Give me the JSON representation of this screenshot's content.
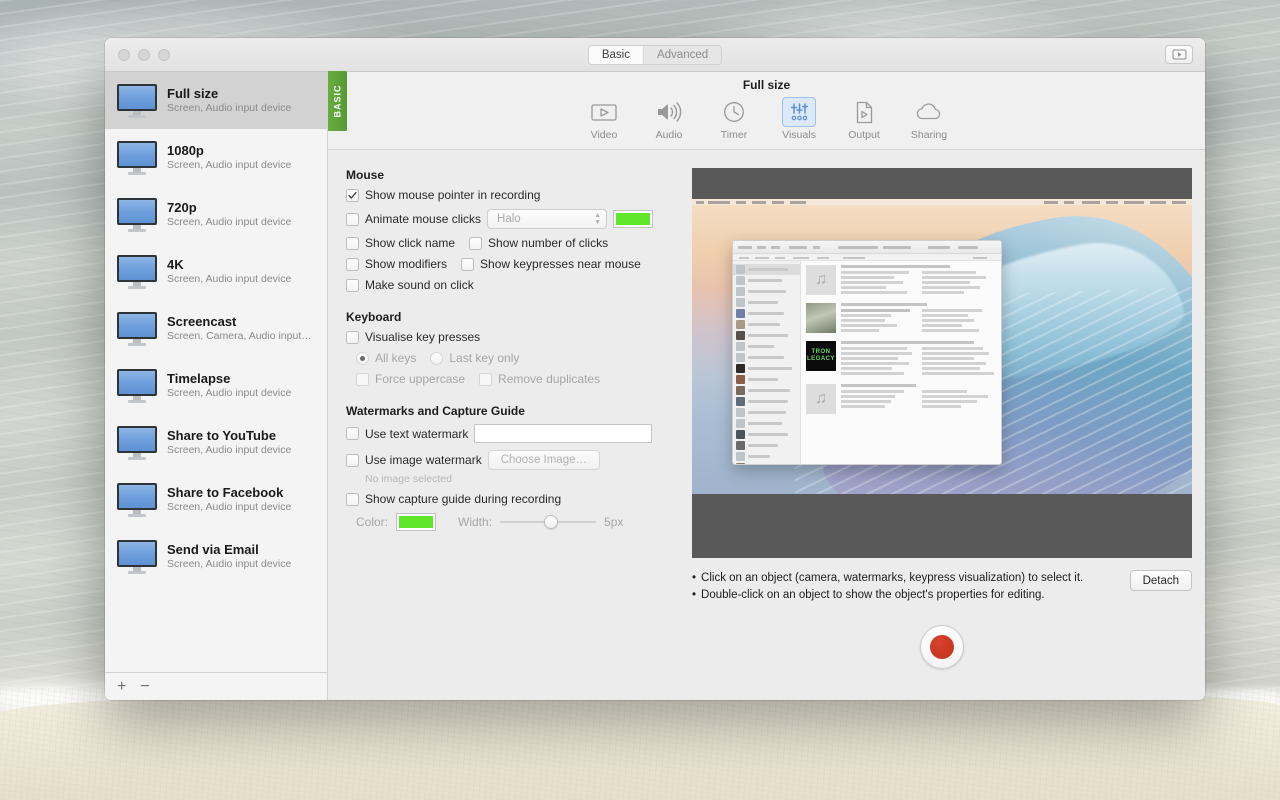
{
  "window": {
    "traffic_lights": [
      "close",
      "minimize",
      "zoom"
    ],
    "mode_tabs": [
      {
        "label": "Basic",
        "selected": true
      },
      {
        "label": "Advanced",
        "selected": false
      }
    ],
    "toolbar_right_icon": "video-play-icon",
    "basic_tab_label": "BASIC"
  },
  "sidebar": {
    "items": [
      {
        "title": "Full size",
        "subtitle": "Screen, Audio input device",
        "icon": "monitor-icon",
        "selected": true
      },
      {
        "title": "1080p",
        "subtitle": "Screen, Audio input device",
        "icon": "monitor-icon",
        "selected": false
      },
      {
        "title": "720p",
        "subtitle": "Screen, Audio input device",
        "icon": "monitor-icon",
        "selected": false
      },
      {
        "title": "4K",
        "subtitle": "Screen, Audio input device",
        "icon": "monitor-icon",
        "selected": false
      },
      {
        "title": "Screencast",
        "subtitle": "Screen, Camera, Audio input…",
        "icon": "monitor-icon",
        "selected": false
      },
      {
        "title": "Timelapse",
        "subtitle": "Screen, Audio input device",
        "icon": "monitor-icon",
        "selected": false
      },
      {
        "title": "Share to YouTube",
        "subtitle": "Screen, Audio input device",
        "icon": "monitor-icon",
        "selected": false
      },
      {
        "title": "Share to Facebook",
        "subtitle": "Screen, Audio input device",
        "icon": "monitor-icon",
        "selected": false
      },
      {
        "title": "Send via Email",
        "subtitle": "Screen, Audio input device",
        "icon": "monitor-icon",
        "selected": false
      }
    ],
    "footer": {
      "add_label": "+",
      "remove_label": "−"
    }
  },
  "main": {
    "panel_title": "Full size",
    "tools": [
      {
        "label": "Video",
        "icon": "video-icon",
        "active": false
      },
      {
        "label": "Audio",
        "icon": "speaker-icon",
        "active": false
      },
      {
        "label": "Timer",
        "icon": "clock-icon",
        "active": false
      },
      {
        "label": "Visuals",
        "icon": "sliders-icon",
        "active": true
      },
      {
        "label": "Output",
        "icon": "document-play-icon",
        "active": false
      },
      {
        "label": "Sharing",
        "icon": "cloud-icon",
        "active": false
      }
    ],
    "mouse": {
      "title": "Mouse",
      "show_pointer": {
        "label": "Show mouse pointer in recording",
        "checked": true
      },
      "animate_clicks": {
        "label": "Animate mouse clicks",
        "checked": false
      },
      "animation_style": {
        "value": "Halo",
        "enabled": false
      },
      "animation_color": "#5FE52A",
      "show_click_name": {
        "label": "Show click name",
        "checked": false
      },
      "show_number_of_clicks": {
        "label": "Show number of clicks",
        "checked": false
      },
      "show_modifiers": {
        "label": "Show modifiers",
        "checked": false
      },
      "show_keypresses_near_mouse": {
        "label": "Show keypresses near mouse",
        "checked": false
      },
      "make_sound_on_click": {
        "label": "Make sound on click",
        "checked": false
      }
    },
    "keyboard": {
      "title": "Keyboard",
      "visualise": {
        "label": "Visualise key presses",
        "checked": false
      },
      "radios": [
        {
          "label": "All keys",
          "selected": true
        },
        {
          "label": "Last key only",
          "selected": false
        }
      ],
      "force_uppercase": {
        "label": "Force uppercase",
        "checked": false
      },
      "remove_duplicates": {
        "label": "Remove duplicates",
        "checked": false
      }
    },
    "watermarks": {
      "title": "Watermarks and Capture Guide",
      "use_text_watermark": {
        "label": "Use text watermark",
        "checked": false
      },
      "text_watermark_value": "",
      "use_image_watermark": {
        "label": "Use image watermark",
        "checked": false
      },
      "choose_image_button": "Choose Image…",
      "no_image_selected": "No image selected",
      "show_capture_guide": {
        "label": "Show capture guide during recording",
        "checked": false
      },
      "color_label": "Color:",
      "guide_color": "#5FE52A",
      "width_label": "Width:",
      "width_value": "5px"
    },
    "preview": {
      "hints": [
        "Click on an object (camera, watermarks, keypress visualization) to select it.",
        "Double-click on an object to show the object's properties for editing."
      ],
      "detach_button": "Detach",
      "record_button": "record-button",
      "tron_cover_text": "TRON LEGACY"
    }
  }
}
